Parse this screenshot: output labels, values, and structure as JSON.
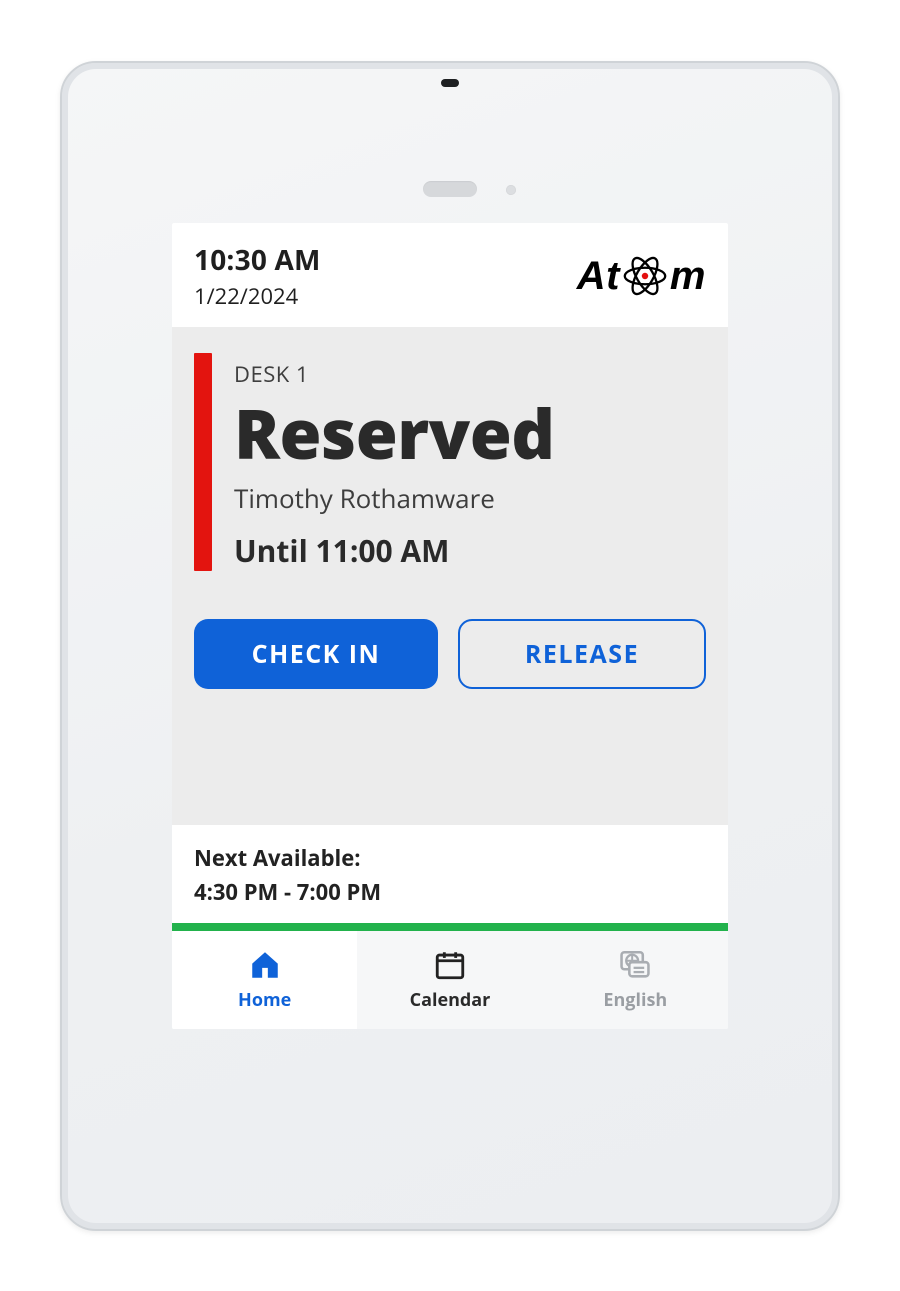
{
  "header": {
    "time": "10:30 AM",
    "date": "1/22/2024",
    "brand_pre": "At",
    "brand_post": "m"
  },
  "status": {
    "desk_label": "DESK 1",
    "state": "Reserved",
    "person": "Timothy Rothamware",
    "until": "Until 11:00 AM",
    "accent_color": "#e3140f"
  },
  "actions": {
    "check_in": "CHECK IN",
    "release": "RELEASE"
  },
  "next_available": {
    "label": "Next Available:",
    "range": "4:30 PM - 7:00 PM"
  },
  "nav": {
    "home": "Home",
    "calendar": "Calendar",
    "language": "English"
  },
  "colors": {
    "primary": "#0f62d8",
    "success": "#22b24c"
  }
}
